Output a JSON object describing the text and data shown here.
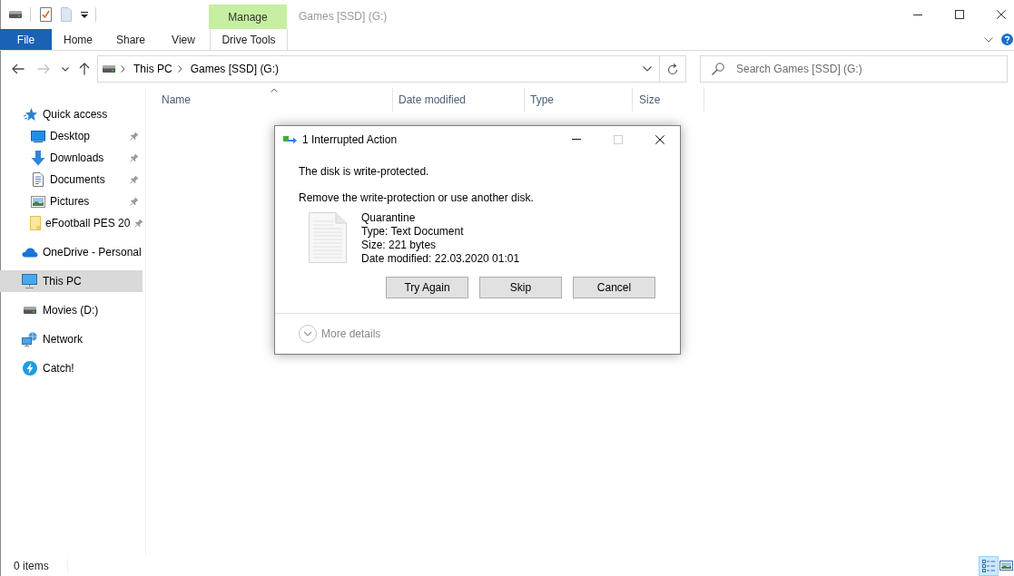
{
  "title_bar": {
    "contextual_group": "Manage",
    "title": "Games [SSD] (G:)"
  },
  "ribbon": {
    "tabs": [
      {
        "label": "File",
        "kind": "file",
        "selected": false
      },
      {
        "label": "Home",
        "kind": "plain",
        "selected": false
      },
      {
        "label": "Share",
        "kind": "plain",
        "selected": false
      },
      {
        "label": "View",
        "kind": "plain",
        "selected": false
      },
      {
        "label": "Drive Tools",
        "kind": "contextual",
        "selected": false
      }
    ]
  },
  "navigation": [
    {
      "kind": "back",
      "disabled": false
    },
    {
      "kind": "forward",
      "disabled": true
    },
    {
      "kind": "recent",
      "disabled": false
    },
    {
      "kind": "up",
      "disabled": false
    }
  ],
  "address_bar": {
    "breadcrumbs": [
      "This PC",
      "Games [SSD] (G:)"
    ]
  },
  "search": {
    "placeholder": "Search Games [SSD] (G:)"
  },
  "sidebar": {
    "items": [
      {
        "label": "Quick access",
        "kind": "star",
        "selected": false,
        "children": [
          {
            "label": "Desktop",
            "kind": "desktop",
            "selected": false,
            "pinned": true
          },
          {
            "label": "Downloads",
            "kind": "download",
            "selected": false,
            "pinned": true
          },
          {
            "label": "Documents",
            "kind": "document",
            "selected": false,
            "pinned": true
          },
          {
            "label": "Pictures",
            "kind": "picture",
            "selected": false,
            "pinned": true
          },
          {
            "label": "eFootball PES 20",
            "kind": "folder",
            "selected": false,
            "pinned": true
          }
        ]
      },
      {
        "label": "OneDrive - Personal",
        "kind": "cloud",
        "selected": false
      },
      {
        "label": "This PC",
        "kind": "computer",
        "selected": true
      },
      {
        "label": "Movies (D:)",
        "kind": "drive",
        "selected": false
      },
      {
        "label": "Network",
        "kind": "network",
        "selected": false
      },
      {
        "label": "Catch!",
        "kind": "bolt",
        "selected": false
      }
    ]
  },
  "file_list": {
    "columns": [
      {
        "label": "Name",
        "sorted": true
      },
      {
        "label": "Date modified",
        "sorted": false
      },
      {
        "label": "Type",
        "sorted": false
      },
      {
        "label": "Size",
        "sorted": false
      }
    ]
  },
  "status_bar": {
    "item_count": "0 items",
    "views": [
      {
        "kind": "details",
        "selected": true
      },
      {
        "kind": "tiles",
        "selected": false
      }
    ]
  },
  "dialog": {
    "title": "1 Interrupted Action",
    "controls": [
      {
        "kind": "minimize",
        "disabled": false
      },
      {
        "kind": "maximize",
        "disabled": true
      },
      {
        "kind": "close",
        "disabled": false
      }
    ],
    "message": "The disk is write-protected.",
    "instruction": "Remove the write-protection or use another disk.",
    "file": {
      "name": "Quarantine",
      "details": [
        "Type: Text Document",
        "Size: 221 bytes",
        "Date modified: 22.03.2020 01:01"
      ]
    },
    "buttons": [
      "Try Again",
      "Skip",
      "Cancel"
    ],
    "more_details": {
      "label": "More details",
      "expanded": false
    }
  }
}
